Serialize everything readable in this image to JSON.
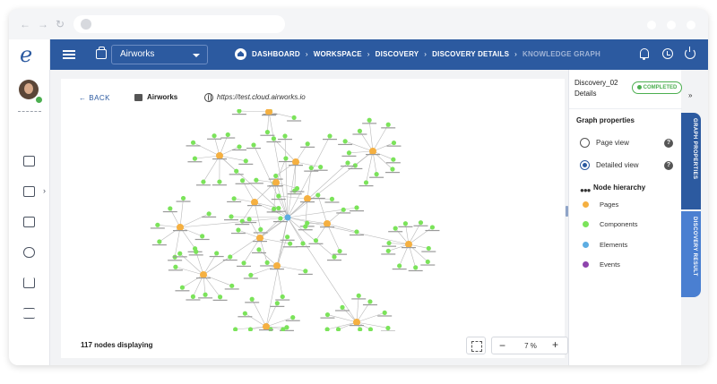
{
  "header": {
    "workspace": "Airworks",
    "breadcrumb": [
      {
        "label": "DASHBOARD"
      },
      {
        "label": "WORKSPACE"
      },
      {
        "label": "DISCOVERY"
      },
      {
        "label": "DISCOVERY DETAILS"
      },
      {
        "label": "KNOWLEDGE GRAPH"
      }
    ]
  },
  "main": {
    "back_label": "BACK",
    "project": "Airworks",
    "url": "https://test.cloud.airworks.io",
    "nodes_count": "117 nodes displaying",
    "zoom": {
      "minus": "−",
      "value": "7 %",
      "plus": "+"
    }
  },
  "panel": {
    "title": "Discovery_02 Details",
    "status": "COMPLETED",
    "collapse": "»",
    "graph_properties": "Graph properties",
    "options": [
      {
        "label": "Page view",
        "selected": false
      },
      {
        "label": "Detailed view",
        "selected": true
      }
    ],
    "help": "?",
    "node_hierarchy": "Node hierarchy",
    "legend": [
      {
        "label": "Pages",
        "color": "#f5b041"
      },
      {
        "label": "Components",
        "color": "#7be35a"
      },
      {
        "label": "Elements",
        "color": "#5dade2"
      },
      {
        "label": "Events",
        "color": "#8e44ad"
      }
    ],
    "tabs": {
      "properties": "GRAPH PROPERTIES",
      "result": "DISCOVERY RESULT"
    }
  },
  "colors": {
    "brand": "#2c5aa0",
    "page_node": "#f5b041",
    "component_node": "#7be35a",
    "element_node": "#5dade2",
    "status": "#4caf50"
  }
}
